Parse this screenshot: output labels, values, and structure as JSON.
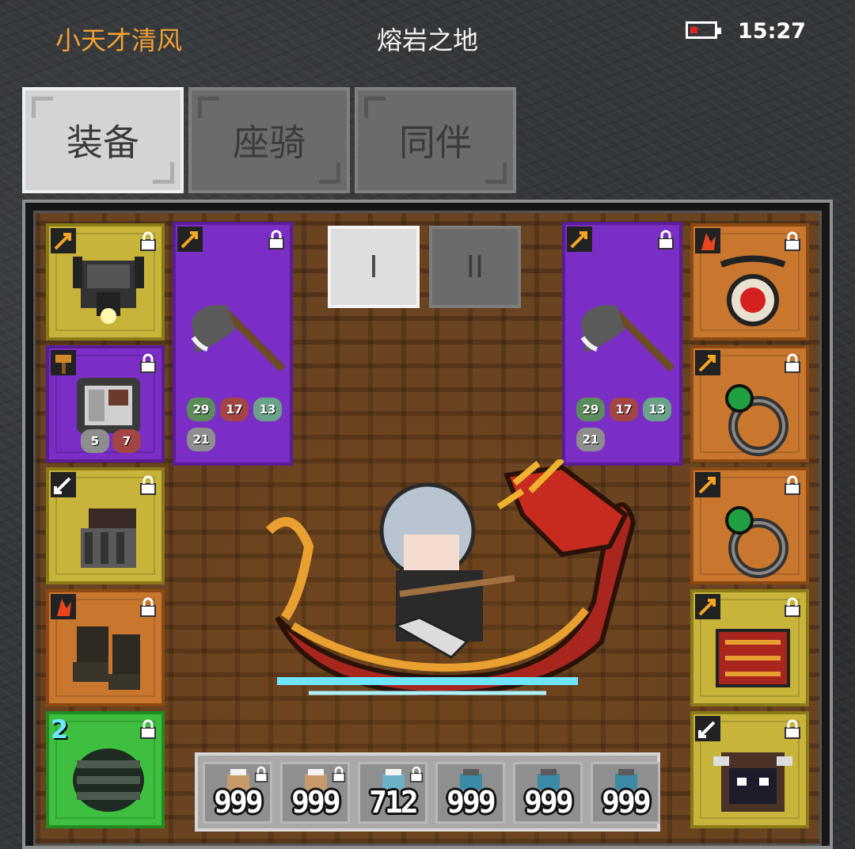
{
  "status_bar": {
    "player_name": "小天才清风",
    "map_name": "熔岩之地",
    "time": "15:27",
    "battery_level": "low"
  },
  "tabs": [
    {
      "label": "装备",
      "active": true
    },
    {
      "label": "座骑",
      "active": false
    },
    {
      "label": "同伴",
      "active": false
    }
  ],
  "weapon_pages": [
    {
      "label": "I",
      "active": true
    },
    {
      "label": "II",
      "active": false
    }
  ],
  "left_slots": [
    {
      "rarity": "yellow",
      "item": "helmet-icon"
    },
    {
      "rarity": "purple",
      "item": "armor-icon",
      "gems": [
        "5",
        "7"
      ]
    },
    {
      "rarity": "yellow",
      "item": "gauntlet-icon"
    },
    {
      "rarity": "orange",
      "item": "boots-icon"
    },
    {
      "rarity": "green",
      "item": "belt-icon",
      "badge": "2"
    }
  ],
  "right_slots": [
    {
      "rarity": "orange",
      "item": "amulet-icon"
    },
    {
      "rarity": "orange",
      "item": "ring-icon"
    },
    {
      "rarity": "orange",
      "item": "ring-icon"
    },
    {
      "rarity": "yellow",
      "item": "cape-icon"
    },
    {
      "rarity": "yellow",
      "item": "pet-icon"
    }
  ],
  "weapons": [
    {
      "item": "axe-icon",
      "gems": [
        "29",
        "17",
        "13",
        "21"
      ]
    },
    {
      "item": "axe-icon",
      "gems": [
        "29",
        "17",
        "13",
        "21"
      ]
    }
  ],
  "consumables": [
    {
      "item": "potion-icon",
      "qty": "999"
    },
    {
      "item": "potion-icon",
      "qty": "999"
    },
    {
      "item": "potion-icon",
      "qty": "712"
    },
    {
      "item": "potion-icon",
      "qty": "999"
    },
    {
      "item": "potion-icon",
      "qty": "999"
    },
    {
      "item": "potion-icon",
      "qty": "999"
    }
  ],
  "colors": {
    "player_name": "#f0a132",
    "rarity_yellow": "#c8b43a",
    "rarity_purple": "#7a2ec6",
    "rarity_orange": "#c9772f",
    "rarity_green": "#3fbf3f"
  }
}
